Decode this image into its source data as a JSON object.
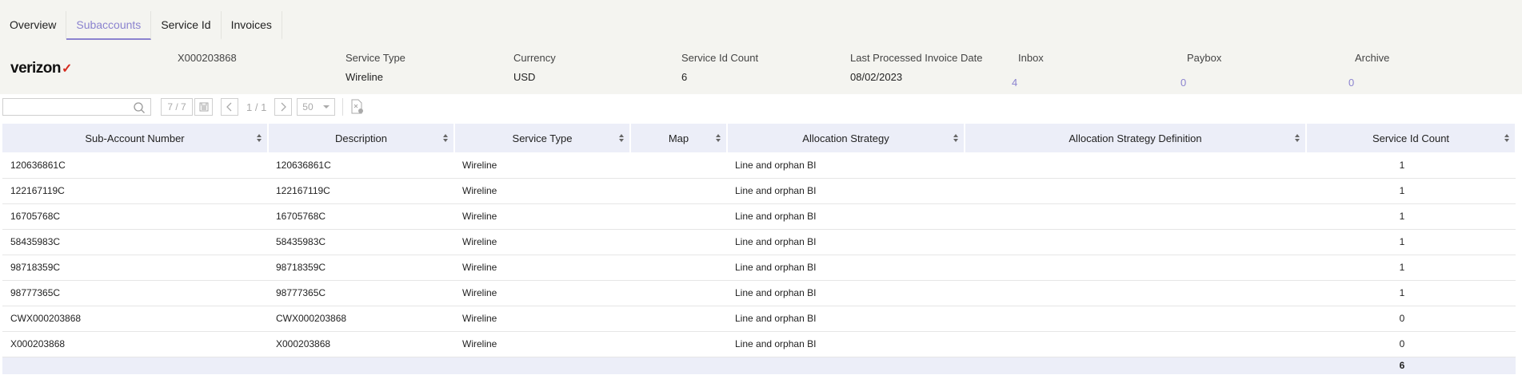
{
  "tabs": [
    {
      "label": "Overview",
      "active": false
    },
    {
      "label": "Subaccounts",
      "active": true
    },
    {
      "label": "Service Id",
      "active": false
    },
    {
      "label": "Invoices",
      "active": false
    }
  ],
  "header": {
    "logo_text": "verizon",
    "account_number": "X000203868",
    "service_type": {
      "label": "Service Type",
      "value": "Wireline"
    },
    "currency": {
      "label": "Currency",
      "value": "USD"
    },
    "service_id_count": {
      "label": "Service Id Count",
      "value": "6"
    },
    "last_processed": {
      "label": "Last Processed Invoice Date",
      "value": "08/02/2023"
    },
    "inbox": {
      "label": "Inbox",
      "count": "4"
    },
    "paybox": {
      "label": "Paybox",
      "count": "0"
    },
    "archive": {
      "label": "Archive",
      "count": "0"
    }
  },
  "toolbar": {
    "search_placeholder": "",
    "record_count": "7 / 7",
    "page_indicator": "1 / 1",
    "page_size": "50"
  },
  "table": {
    "columns": [
      "Sub-Account Number",
      "Description",
      "Service Type",
      "Map",
      "Allocation Strategy",
      "Allocation Strategy Definition",
      "Service Id Count"
    ],
    "rows": [
      {
        "sub": "120636861C",
        "desc": "120636861C",
        "type": "Wireline",
        "map": "",
        "strategy": "Line and orphan BI",
        "definition": "",
        "count": "1"
      },
      {
        "sub": "122167119C",
        "desc": "122167119C",
        "type": "Wireline",
        "map": "",
        "strategy": "Line and orphan BI",
        "definition": "",
        "count": "1"
      },
      {
        "sub": "16705768C",
        "desc": "16705768C",
        "type": "Wireline",
        "map": "",
        "strategy": "Line and orphan BI",
        "definition": "",
        "count": "1"
      },
      {
        "sub": "58435983C",
        "desc": "58435983C",
        "type": "Wireline",
        "map": "",
        "strategy": "Line and orphan BI",
        "definition": "",
        "count": "1"
      },
      {
        "sub": "98718359C",
        "desc": "98718359C",
        "type": "Wireline",
        "map": "",
        "strategy": "Line and orphan BI",
        "definition": "",
        "count": "1"
      },
      {
        "sub": "98777365C",
        "desc": "98777365C",
        "type": "Wireline",
        "map": "",
        "strategy": "Line and orphan BI",
        "definition": "",
        "count": "1"
      },
      {
        "sub": "CWX000203868",
        "desc": "CWX000203868",
        "type": "Wireline",
        "map": "",
        "strategy": "Line and orphan BI",
        "definition": "",
        "count": "0"
      },
      {
        "sub": "X000203868",
        "desc": "X000203868",
        "type": "Wireline",
        "map": "",
        "strategy": "Line and orphan BI",
        "definition": "",
        "count": "0"
      }
    ],
    "total_count": "6"
  },
  "colors": {
    "accent": "#8b83cf",
    "header_row": "#eceef8",
    "logo_check": "#d52b1e"
  },
  "icons": [
    "search-icon",
    "export-icon",
    "prev-page-icon",
    "next-page-icon",
    "dropdown-icon",
    "clear-filter-icon",
    "sort-icon"
  ]
}
